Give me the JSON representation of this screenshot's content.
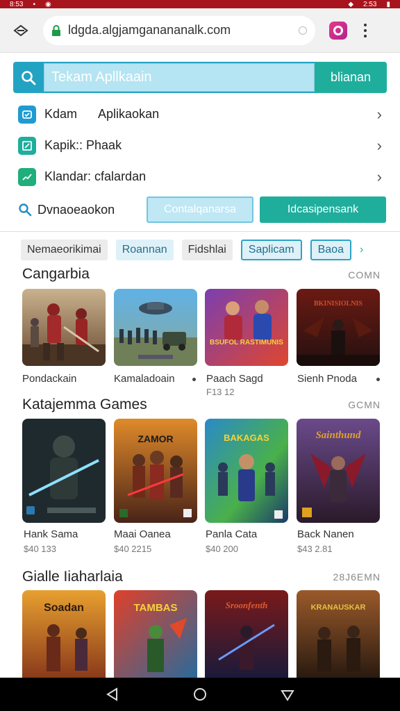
{
  "status_bar": {
    "time_left": "8:53",
    "time_right": "2:53"
  },
  "browser": {
    "url": "ldgda.algjamganananalk.com"
  },
  "search": {
    "placeholder": "Tekam Apllkaain",
    "button": "blianan"
  },
  "menu": [
    {
      "label_a": "Kdam",
      "label_b": "Aplikaokan",
      "icon": "clock-icon",
      "color": "#1f9bd1"
    },
    {
      "label_a": "Kapik:: Phaak",
      "label_b": "",
      "icon": "edit-icon",
      "color": "#1fae9c"
    },
    {
      "label_a": "Klandar: cfalardan",
      "label_b": "",
      "icon": "chart-icon",
      "color": "#1fae7c"
    }
  ],
  "actions": {
    "search_label": "Dvnaoeaokon",
    "btn_light": "Contalqanarsa",
    "btn_dark": "Idcasipensank"
  },
  "chips": [
    "Nemaeorikimai",
    "Roannan",
    "Fidshlai",
    "Saplicam",
    "Baoa"
  ],
  "sections": [
    {
      "title": "Cangarbia",
      "more": "COMN",
      "items": [
        {
          "name": "Pondackain",
          "sub": ""
        },
        {
          "name": "Kamaladoain",
          "sub": ""
        },
        {
          "name": "Paach Sagd",
          "sub": "F13 12"
        },
        {
          "name": "Sienh Pnoda",
          "sub": ""
        }
      ]
    },
    {
      "title": "Katajemma Games",
      "more": "GCMN",
      "items": [
        {
          "name": "Hank Sama",
          "sub": "$40 133"
        },
        {
          "name": "Maai Oanea",
          "sub": "$40 2215"
        },
        {
          "name": "Panla Cata",
          "sub": "$40 200"
        },
        {
          "name": "Back Nanen",
          "sub": "$43 2.81"
        }
      ]
    },
    {
      "title": "Gialle Iiaharlaia",
      "more": "28J6EMN",
      "items": [
        {
          "name": "",
          "sub": ""
        },
        {
          "name": "",
          "sub": ""
        },
        {
          "name": "",
          "sub": ""
        },
        {
          "name": "",
          "sub": ""
        }
      ]
    }
  ],
  "tile_text": {
    "s1_t3": "BSUFOL RASTIMUNIS",
    "s1_t4": "BKINISIOLNIS",
    "s2_t2": "ZAMOR",
    "s2_t3": "BAKAGAS",
    "s2_t4": "Sainthund",
    "s3_t1": "Soadan",
    "s3_t2": "TAMBAS",
    "s3_t3": "Sroonfenth",
    "s3_t4": "KRANAUSKAR"
  },
  "colors": {
    "accent_teal": "#1fae9c",
    "accent_blue": "#23a3c4",
    "status_red": "#a8141c"
  }
}
